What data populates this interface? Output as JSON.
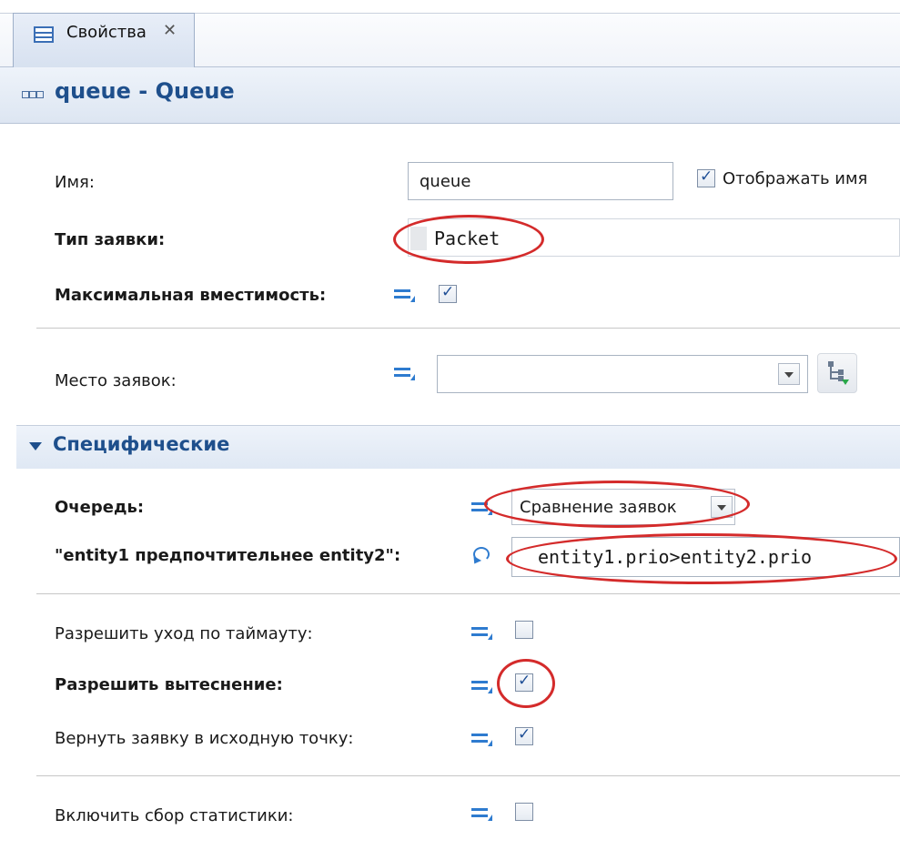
{
  "tab": {
    "label": "Свойства",
    "close_glyph": "✕"
  },
  "header": {
    "title": "queue - Queue"
  },
  "fields": {
    "name_label": "Имя:",
    "name_value": "queue",
    "show_name_label": "Отображать имя",
    "show_name_checked": true,
    "type_label": "Тип заявки:",
    "type_value": "Packet",
    "capacity_label": "Максимальная вместимость:",
    "capacity_checked": true,
    "place_label": "Место заявок:",
    "place_value": ""
  },
  "section": {
    "title": "Специфические",
    "queue_label": "Очередь:",
    "queue_value": "Сравнение заявок",
    "compare_label": "\"entity1 предпочтительнее entity2\":",
    "compare_value": "entity1.prio>entity2.prio",
    "timeout_label": "Разрешить уход по таймауту:",
    "timeout_checked": false,
    "preemption_label": "Разрешить вытеснение:",
    "preemption_checked": true,
    "return_label": "Вернуть заявку в исходную точку:",
    "return_checked": true,
    "stats_label": "Включить сбор статистики:",
    "stats_checked": false
  },
  "icons": {
    "tab": "properties-table-icon",
    "header": "queue-block-icon",
    "equals": "static-value-equals-icon",
    "dynamic": "dynamic-expression-icon",
    "tree": "select-tree-icon"
  },
  "colors": {
    "accent": "#1e4f8c",
    "highlight_oval": "#d42b2b",
    "icon_blue": "#2e7bcf"
  }
}
